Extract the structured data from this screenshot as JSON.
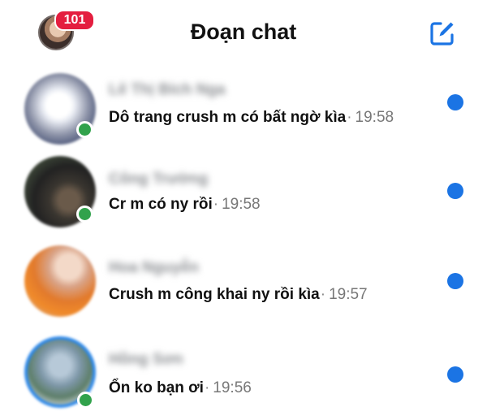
{
  "header": {
    "title": "Đoạn chat",
    "notification_count": "101",
    "compose_icon": "compose-icon"
  },
  "colors": {
    "badge": "#e41e3f",
    "unread_dot": "#1b74e4",
    "online_dot": "#31a24c",
    "accent": "#1b74e4"
  },
  "conversations": [
    {
      "name": "Lê Thị Bích Nga",
      "message": "Dô trang crush m có bất ngờ kìa",
      "separator": "·",
      "time": "19:58",
      "online": true,
      "unread": true
    },
    {
      "name": "Công Trường",
      "message": "Cr m có ny rồi",
      "separator": "·",
      "time": "19:58",
      "online": true,
      "unread": true
    },
    {
      "name": "Hoa Nguyễn",
      "message": "Crush m công khai ny rồi kìa",
      "separator": "·",
      "time": "19:57",
      "online": false,
      "unread": true
    },
    {
      "name": "Hồng Sơn",
      "message": "Ổn ko bạn ơi",
      "separator": "·",
      "time": "19:56",
      "online": true,
      "unread": true
    }
  ]
}
